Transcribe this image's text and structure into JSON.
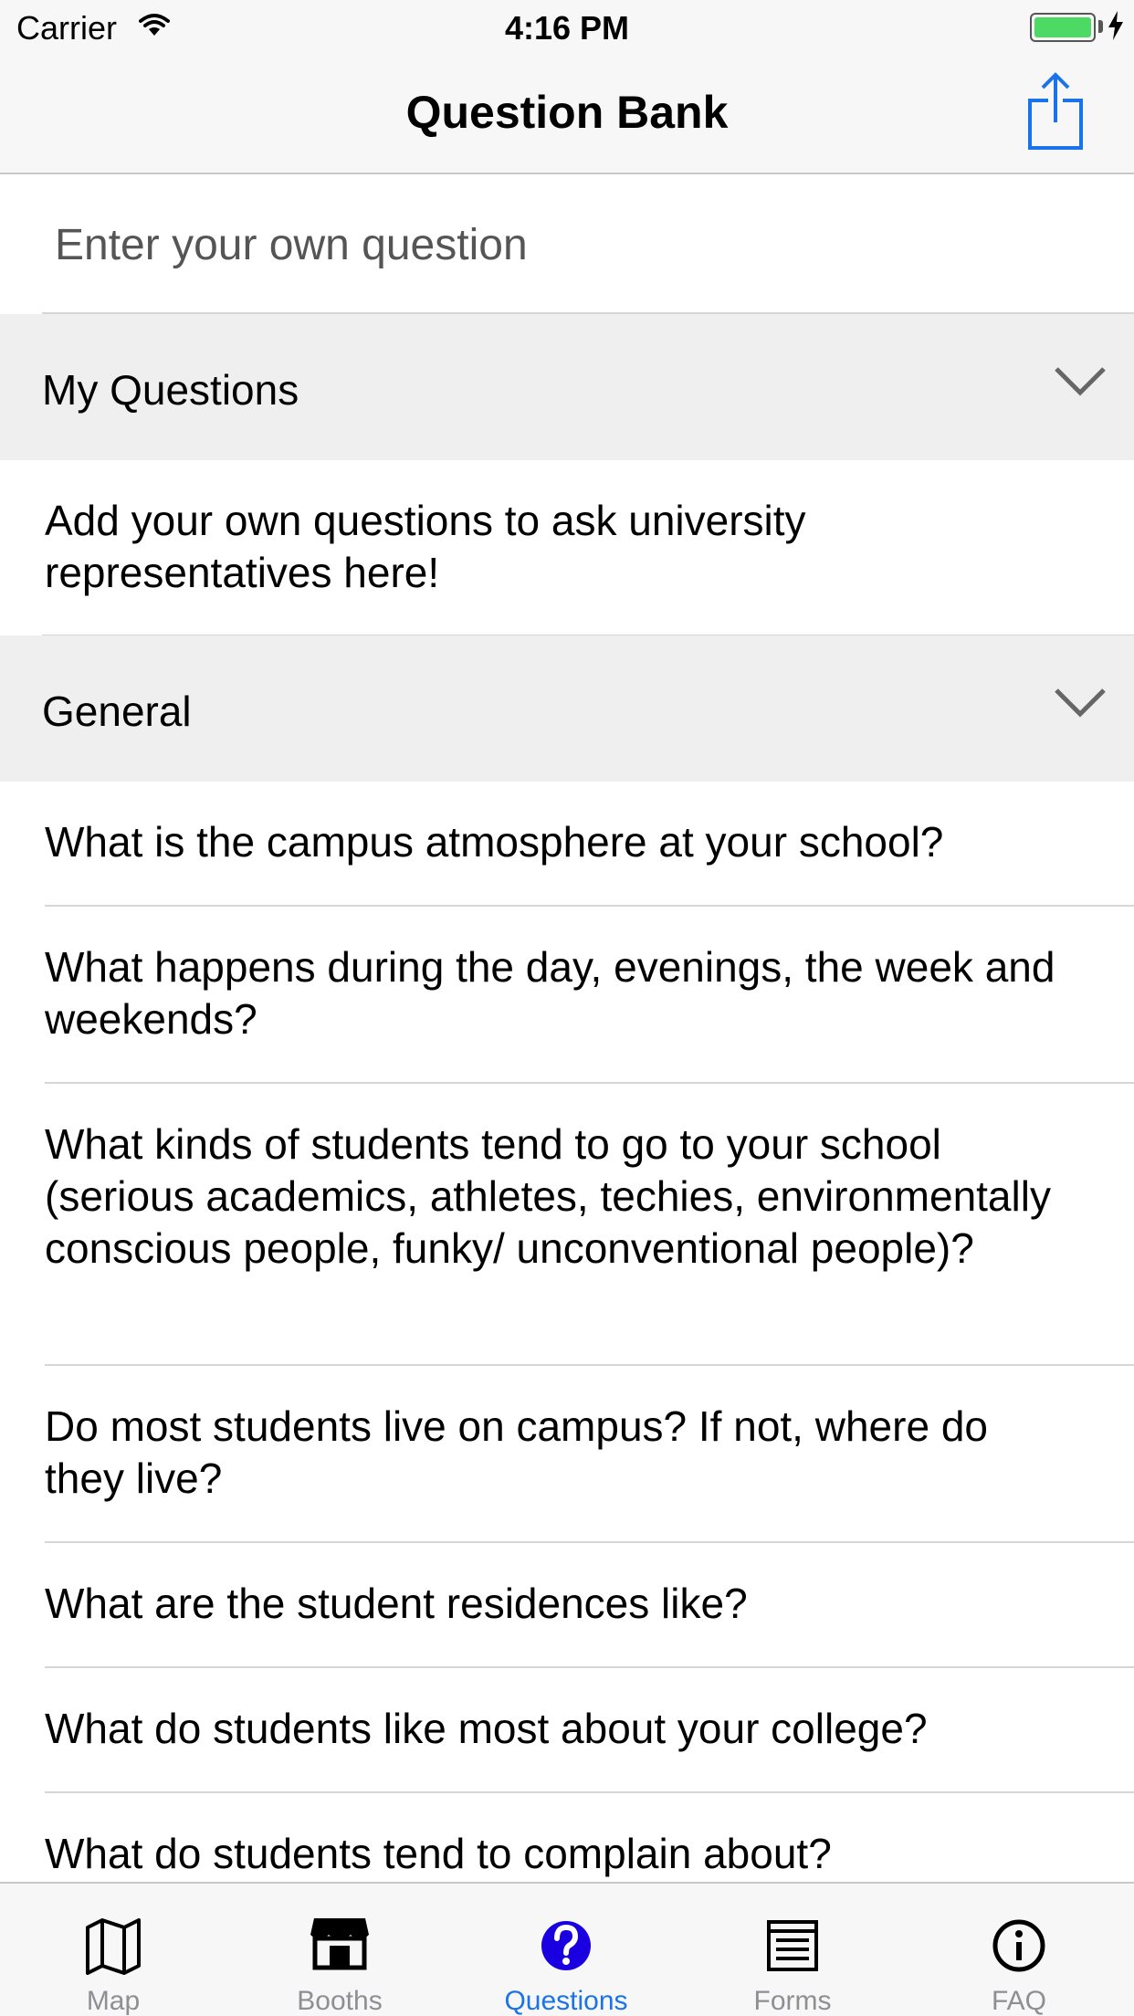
{
  "status_bar": {
    "carrier": "Carrier",
    "time": "4:16 PM"
  },
  "nav": {
    "title": "Question Bank",
    "share_icon": "share-icon"
  },
  "input": {
    "placeholder": "Enter your own question",
    "value": ""
  },
  "sections": [
    {
      "title": "My Questions",
      "rows": [
        "Add your own questions to ask university representatives here!"
      ]
    },
    {
      "title": "General",
      "rows": [
        "What is the campus atmosphere at your school?",
        "What happens during the day, evenings, the week and weekends?",
        "What kinds of students tend to go to your school (serious academics, athletes, techies, environmentally conscious people, funky/ unconventional people)?",
        "Do most students live on campus? If not, where do they live?",
        "What are the student residences like?",
        "What do students like most about your college?",
        "What do students tend to complain about?"
      ]
    }
  ],
  "tabs": [
    {
      "label": "Map",
      "icon": "map-icon",
      "active": false
    },
    {
      "label": "Booths",
      "icon": "booth-icon",
      "active": false
    },
    {
      "label": "Questions",
      "icon": "question-icon",
      "active": true
    },
    {
      "label": "Forms",
      "icon": "forms-icon",
      "active": false
    },
    {
      "label": "FAQ",
      "icon": "info-icon",
      "active": false
    }
  ],
  "colors": {
    "accent": "#1a73e8",
    "inactive": "#8e8e93",
    "section_bg": "#efefef",
    "battery": "#4cd964"
  }
}
